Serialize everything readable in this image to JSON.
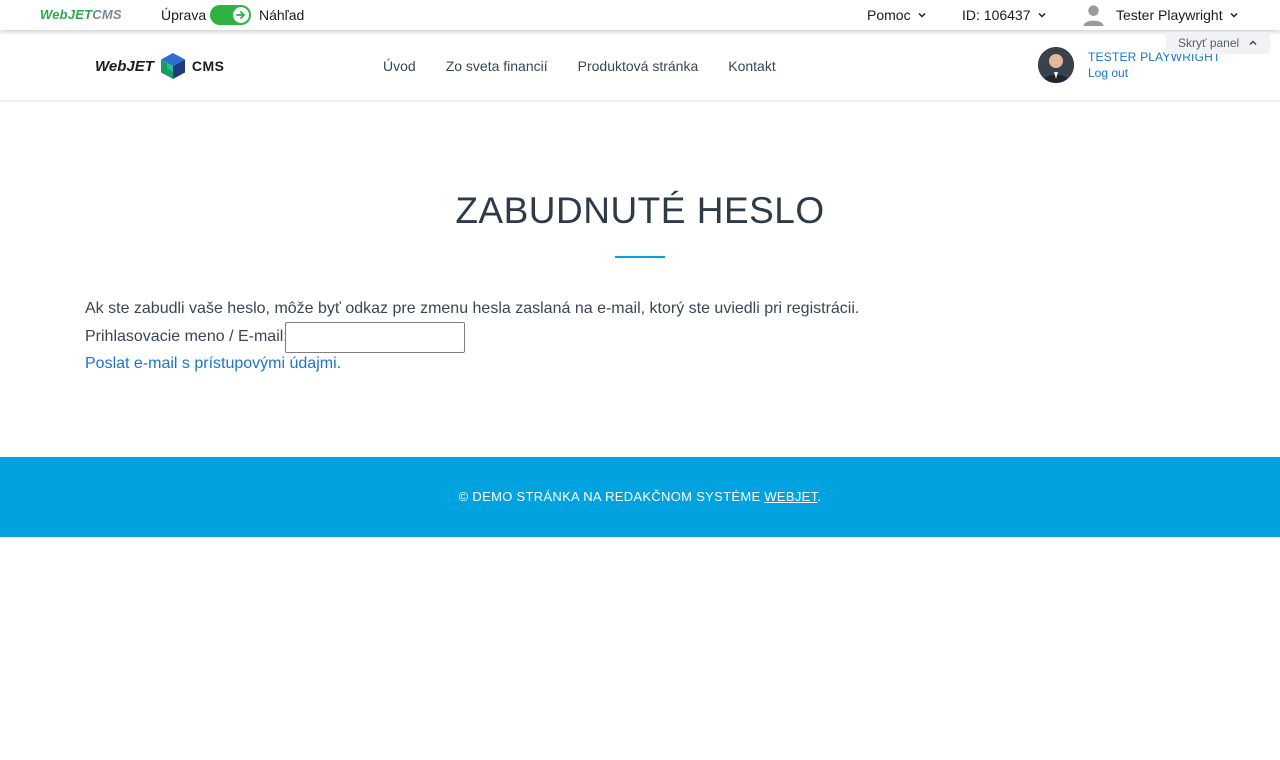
{
  "admin_bar": {
    "logo_web": "Web",
    "logo_jet": "JET",
    "logo_cms": "CMS",
    "mode_edit_label": "Úprava",
    "mode_preview_label": "Náhľad",
    "help_label": "Pomoc",
    "page_id_label": "ID: 106437",
    "user_label": "Tester Playwright",
    "hide_panel_label": "Skryť panel",
    "toggle_state": "on"
  },
  "site_header": {
    "logo_text_left": "WebJET",
    "logo_text_right": "CMS",
    "nav": [
      {
        "label": "Úvod"
      },
      {
        "label": "Zo sveta financií"
      },
      {
        "label": "Produktová stránka"
      },
      {
        "label": "Kontakt"
      }
    ],
    "profile_name": "TESTER PLAYWRIGHT",
    "logout_label": "Log out"
  },
  "main": {
    "title": "ZABUDNUTÉ HESLO",
    "intro_text": "Ak ste zabudli vaše heslo, môže byť odkaz pre zmenu hesla zaslaná na e-mail, ktorý ste uviedli pri registrácii.",
    "login_label": "Prihlasovacie meno / E-mail:",
    "login_value": "",
    "send_link_label": "Poslat e-mail s prístupovými údajmi."
  },
  "footer": {
    "text": "© DEMO STRÁNKA NA REDAKČNOM SYSTÉME ",
    "link_label": "WEBJET",
    "suffix": "."
  },
  "colors": {
    "accent_blue": "#00a3e0",
    "link_blue": "#1a73d1",
    "toggle_green": "#2db341",
    "logo_green": "#2ea84a"
  }
}
